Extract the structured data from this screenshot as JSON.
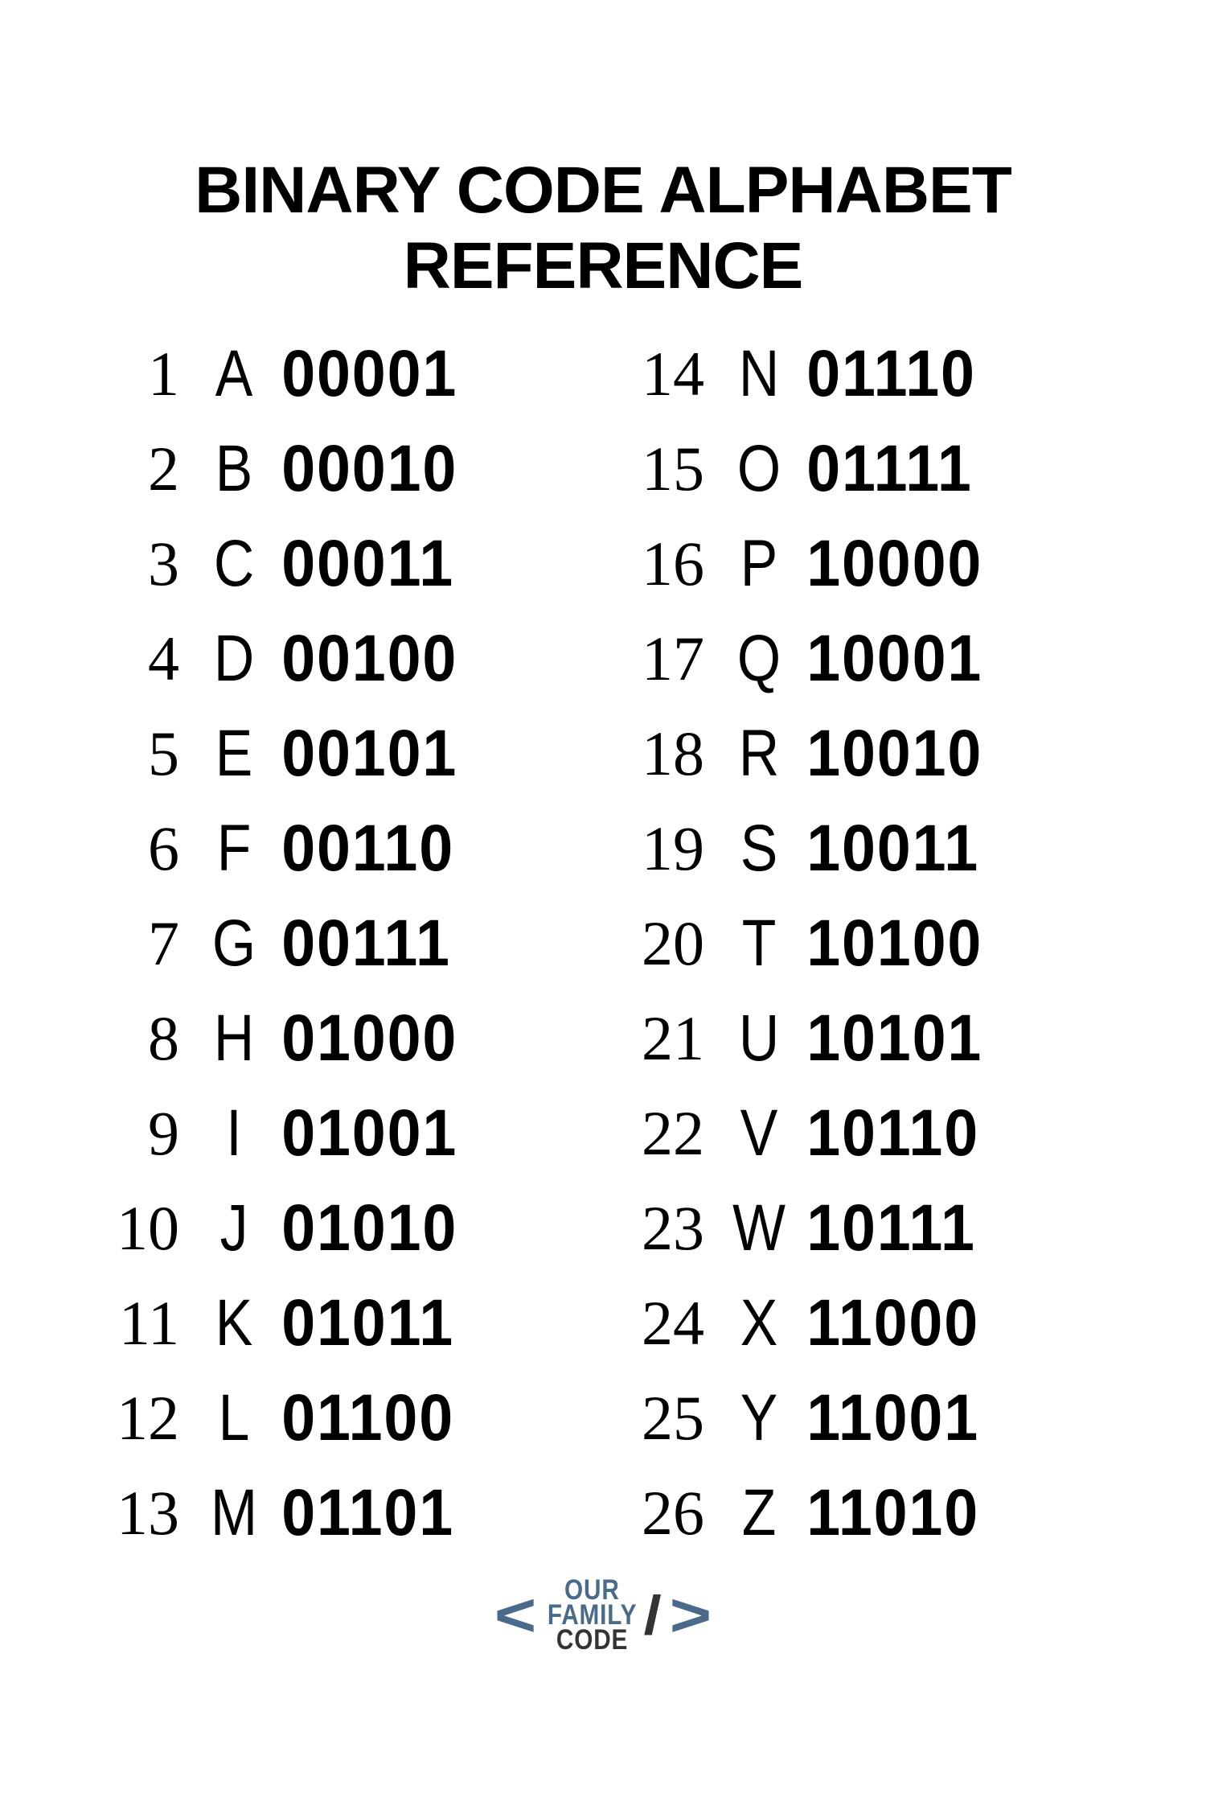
{
  "title": "BINARY CODE ALPHABET REFERENCE",
  "left": [
    {
      "num": "1",
      "letter": "A",
      "binary": "00001"
    },
    {
      "num": "2",
      "letter": "B",
      "binary": "00010"
    },
    {
      "num": "3",
      "letter": "C",
      "binary": "00011"
    },
    {
      "num": "4",
      "letter": "D",
      "binary": "00100"
    },
    {
      "num": "5",
      "letter": "E",
      "binary": "00101"
    },
    {
      "num": "6",
      "letter": "F",
      "binary": "00110"
    },
    {
      "num": "7",
      "letter": "G",
      "binary": "00111"
    },
    {
      "num": "8",
      "letter": "H",
      "binary": "01000"
    },
    {
      "num": "9",
      "letter": "I",
      "binary": "01001"
    },
    {
      "num": "10",
      "letter": "J",
      "binary": "01010"
    },
    {
      "num": "11",
      "letter": "K",
      "binary": "01011"
    },
    {
      "num": "12",
      "letter": "L",
      "binary": "01100"
    },
    {
      "num": "13",
      "letter": "M",
      "binary": "01101"
    }
  ],
  "right": [
    {
      "num": "14",
      "letter": "N",
      "binary": "01110"
    },
    {
      "num": "15",
      "letter": "O",
      "binary": "01111"
    },
    {
      "num": "16",
      "letter": "P",
      "binary": "10000"
    },
    {
      "num": "17",
      "letter": "Q",
      "binary": "10001"
    },
    {
      "num": "18",
      "letter": "R",
      "binary": "10010"
    },
    {
      "num": "19",
      "letter": "S",
      "binary": "10011"
    },
    {
      "num": "20",
      "letter": "T",
      "binary": "10100"
    },
    {
      "num": "21",
      "letter": "U",
      "binary": "10101"
    },
    {
      "num": "22",
      "letter": "V",
      "binary": "10110"
    },
    {
      "num": "23",
      "letter": "W",
      "binary": "10111"
    },
    {
      "num": "24",
      "letter": "X",
      "binary": "11000"
    },
    {
      "num": "25",
      "letter": "Y",
      "binary": "11001"
    },
    {
      "num": "26",
      "letter": "Z",
      "binary": "11010"
    }
  ],
  "logo": {
    "bracket_open": "<",
    "bracket_close": ">",
    "slash": "/",
    "line1": "OUR",
    "line2": "FAMILY",
    "line3": "CODE"
  }
}
